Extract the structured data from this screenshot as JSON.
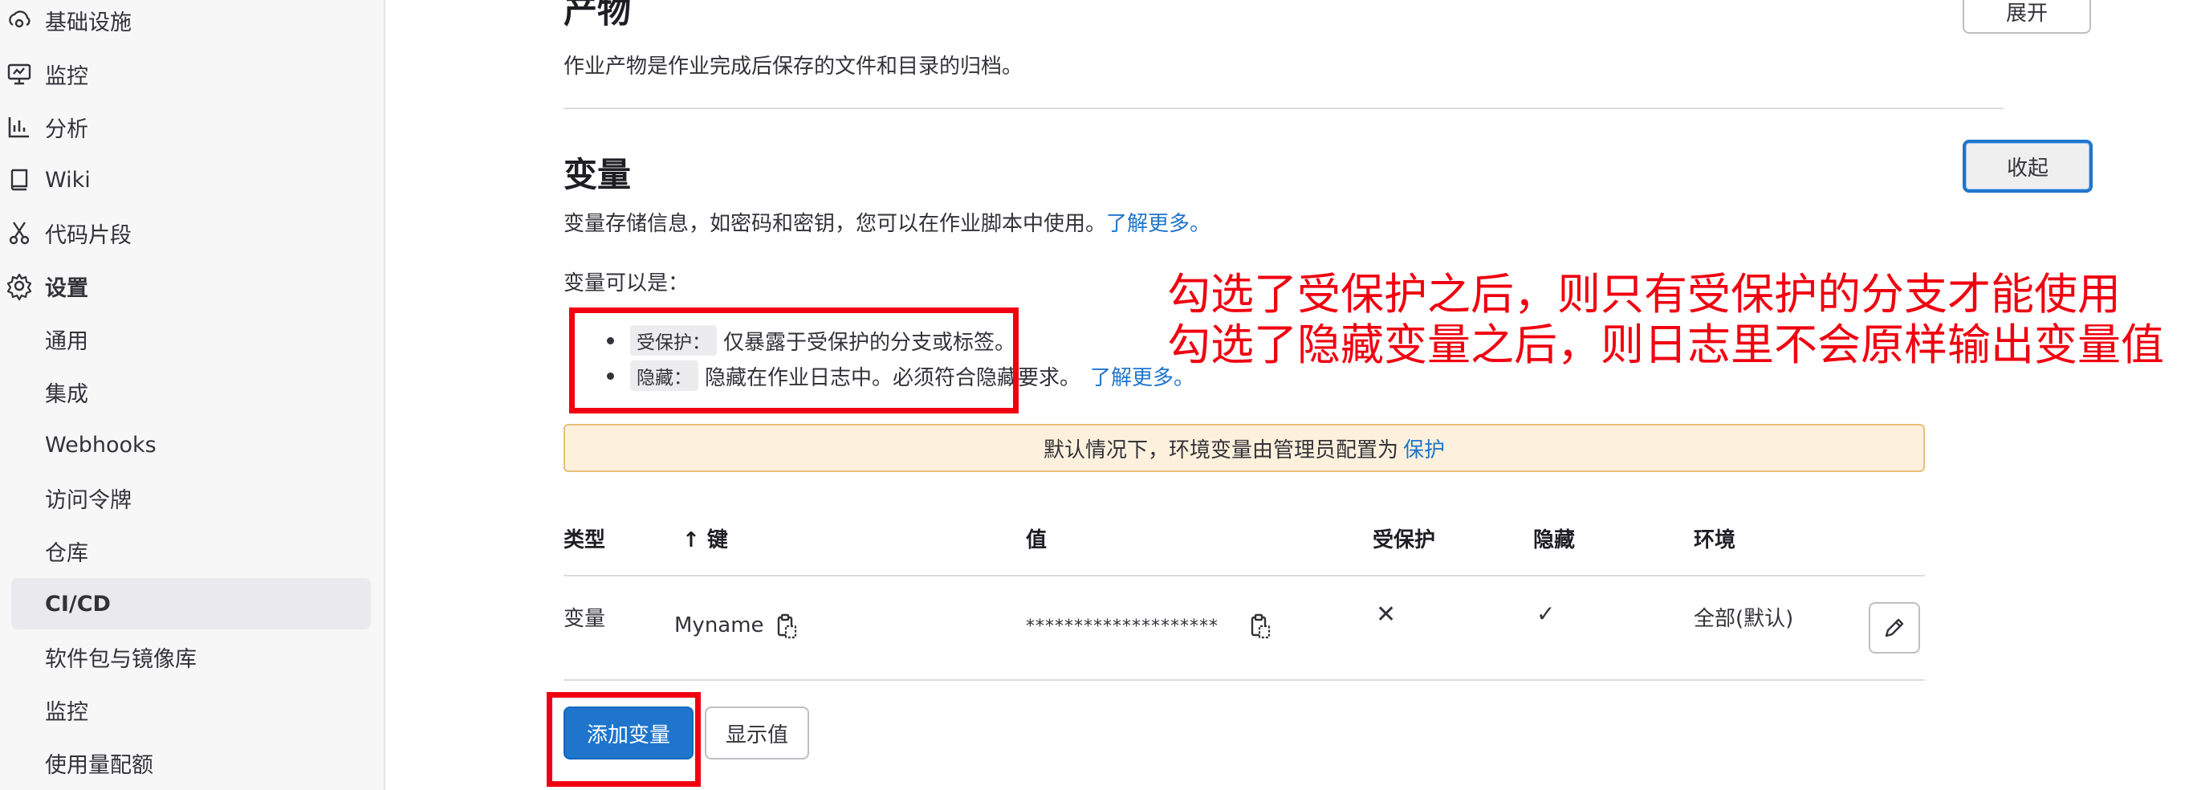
{
  "sidebar": {
    "items": [
      {
        "label": "基础设施",
        "icon": "cloud-gear-icon"
      },
      {
        "label": "监控",
        "icon": "monitor-icon"
      },
      {
        "label": "分析",
        "icon": "chart-icon"
      },
      {
        "label": "Wiki",
        "icon": "book-icon"
      },
      {
        "label": "代码片段",
        "icon": "scissors-icon"
      },
      {
        "label": "设置",
        "icon": "gear-icon"
      },
      {
        "label": "通用"
      },
      {
        "label": "集成"
      },
      {
        "label": "Webhooks"
      },
      {
        "label": "访问令牌"
      },
      {
        "label": "仓库"
      },
      {
        "label": "CI/CD"
      },
      {
        "label": "软件包与镜像库"
      },
      {
        "label": "监控"
      },
      {
        "label": "使用量配额"
      }
    ]
  },
  "artifacts": {
    "title": "产物",
    "description": "作业产物是作业完成后保存的文件和目录的归档。",
    "expand_button": "展开"
  },
  "variables": {
    "title": "变量",
    "collapse_button": "收起",
    "description": "变量存储信息，如密码和密钥，您可以在作业脚本中使用。",
    "learn_more": "了解更多。",
    "can_be": "变量可以是：",
    "bullets": [
      {
        "code": "受保护：",
        "text": "仅暴露于受保护的分支或标签。"
      },
      {
        "code": "隐藏：",
        "text": "隐藏在作业日志中。必须符合隐藏要求。",
        "link": "了解更多。"
      }
    ],
    "alert_text": "默认情况下，环境变量由管理员配置为",
    "alert_link": "保护",
    "table": {
      "headers": [
        "类型",
        "↑ 键",
        "值",
        "受保护",
        "隐藏",
        "环境"
      ],
      "rows": [
        {
          "type": "变量",
          "key": "Myname",
          "value": "********************",
          "protected": "✕",
          "masked": "✓",
          "environment": "全部(默认)"
        }
      ]
    },
    "add_button": "添加变量",
    "reveal_button": "显示值"
  },
  "annotations": {
    "line1": "勾选了受保护之后，则只有受保护的分支才能使用",
    "line2": "勾选了隐藏变量之后，则日志里不会原样输出变量值",
    "color": "#f00010"
  },
  "colors": {
    "link": "#1f75cb",
    "primary": "#1f75cb",
    "alert_bg": "#fdf1dd"
  }
}
